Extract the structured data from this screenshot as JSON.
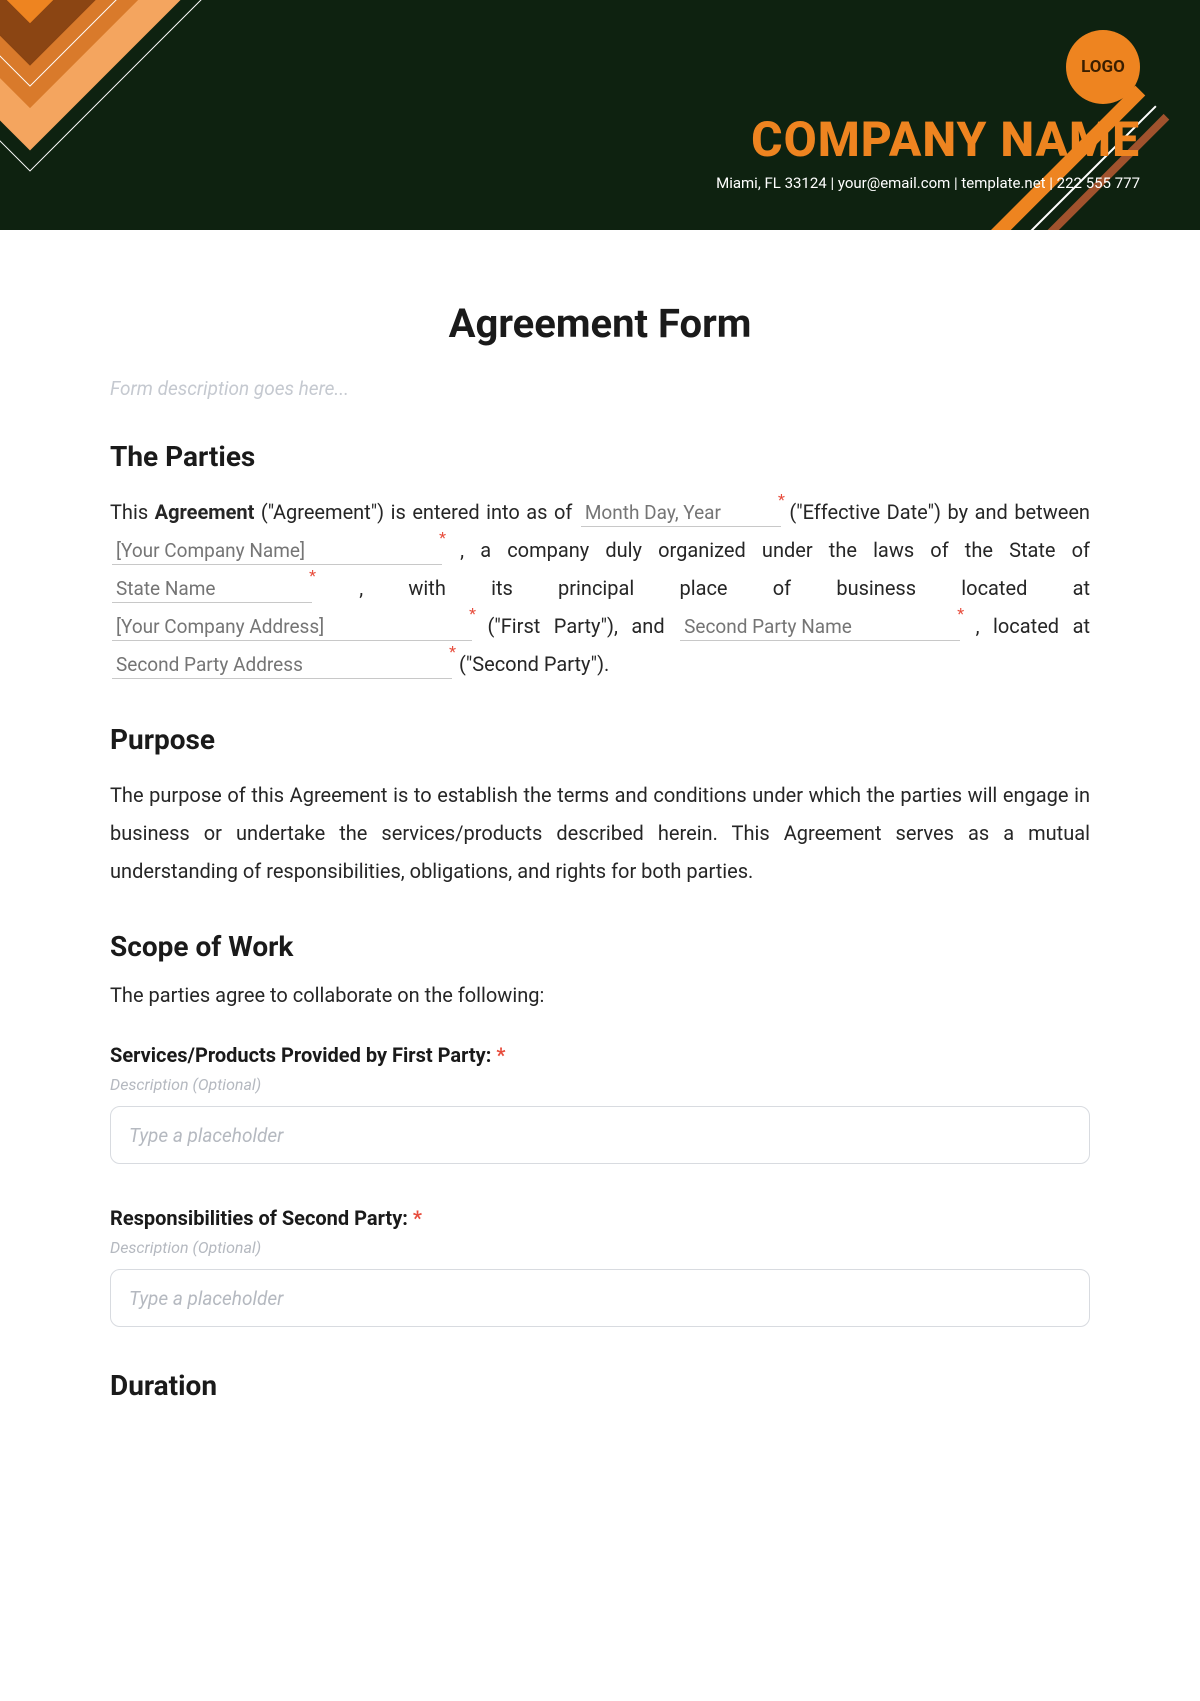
{
  "header": {
    "logo_text": "LOGO",
    "company_name": "COMPANY NAME",
    "contact_line": "Miami, FL 33124 | your@email.com | template.net | 222 555 777"
  },
  "form": {
    "title": "Agreement Form",
    "description": "Form description goes here..."
  },
  "sections": {
    "parties": {
      "heading": "The Parties",
      "text_1a": "This ",
      "text_1b": "Agreement",
      "text_1c": " (\"Agreement\") is entered into as of ",
      "text_2": " (\"Effective Date\") by and between ",
      "text_3": ", a company duly organized under the laws of the State of ",
      "text_4": ", with its principal place of business located at ",
      "text_5": " (\"First Party\"), and ",
      "text_6": ", located at ",
      "text_7": " (\"Second Party\").",
      "fields": {
        "date_ph": "Month Day, Year",
        "company_ph": "[Your Company Name]",
        "state_ph": "State Name",
        "address_ph": "[Your Company Address]",
        "second_name_ph": "Second Party Name",
        "second_address_ph": "Second Party Address"
      }
    },
    "purpose": {
      "heading": "Purpose",
      "text": "The purpose of this Agreement is to establish the terms and conditions under which the parties will engage in business or undertake the services/products described herein. This Agreement serves as a mutual understanding of responsibilities, obligations, and rights for both parties."
    },
    "scope": {
      "heading": "Scope of Work",
      "lead": "The parties agree to collaborate on the following:",
      "first_party_label": "Services/Products Provided by First Party:",
      "second_party_label": "Responsibilities of Second Party:",
      "desc_optional": "Description (Optional)",
      "placeholder": "Type a placeholder",
      "star": "*"
    },
    "duration": {
      "heading": "Duration"
    }
  }
}
